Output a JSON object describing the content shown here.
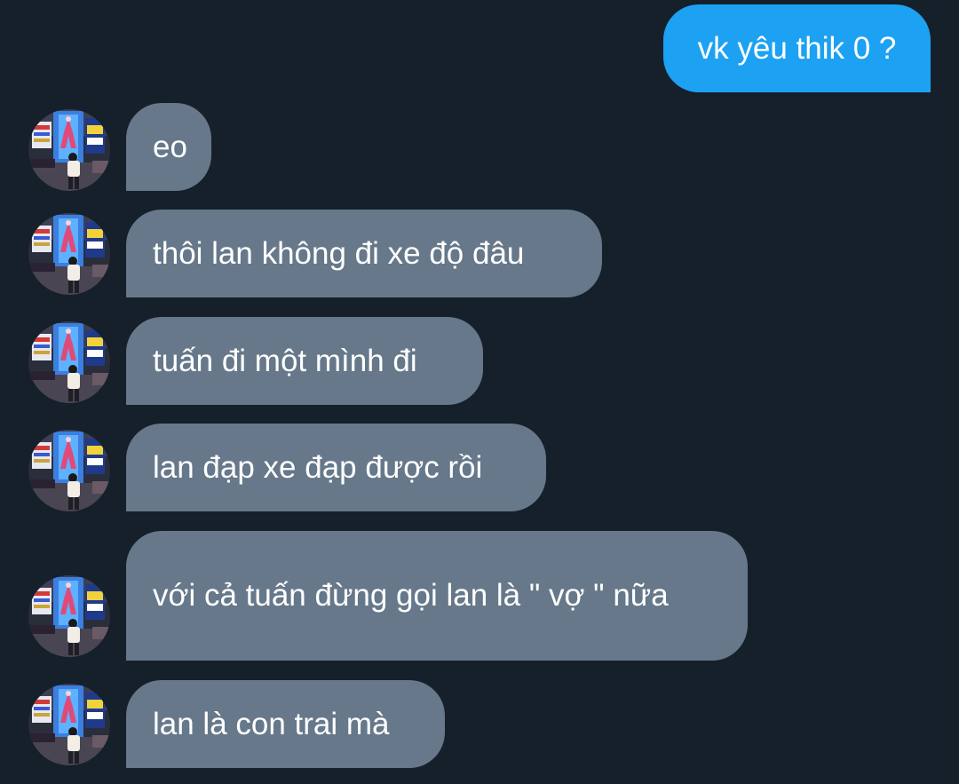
{
  "conversation": {
    "outgoing": [
      {
        "text": "vk yêu thik 0 ?"
      }
    ],
    "incoming": [
      {
        "text": "eo"
      },
      {
        "text": "thôi lan không đi xe độ đâu"
      },
      {
        "text": "tuấn đi một mình đi"
      },
      {
        "text": "lan đạp xe đạp được rồi"
      },
      {
        "text": "với cả tuấn đừng gọi lan là \" vợ \" nữa"
      },
      {
        "text": "lan là con trai mà"
      }
    ]
  },
  "colors": {
    "background": "#15202b",
    "outgoing_bubble": "#1da1f2",
    "incoming_bubble": "#66788a",
    "text": "#ffffff"
  },
  "icons": {
    "avatar": "contact-avatar-photo"
  }
}
